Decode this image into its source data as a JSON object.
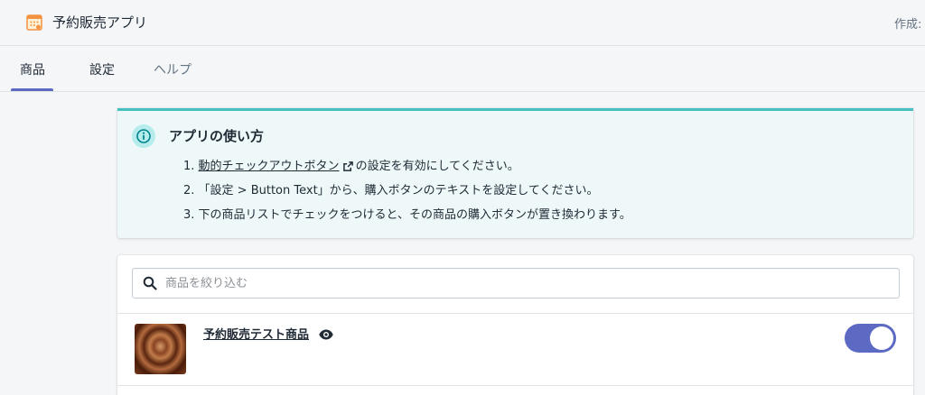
{
  "header": {
    "app_title": "予約販売アプリ",
    "author_label": "作成: ",
    "app_icon": "calendar-icon"
  },
  "tabs": [
    {
      "label": "商品",
      "active": true
    },
    {
      "label": "設定",
      "active": false
    },
    {
      "label": "ヘルプ",
      "active": false
    }
  ],
  "banner": {
    "icon": "info-icon",
    "title": "アプリの使い方",
    "steps": [
      {
        "prefix": "1. ",
        "link": "動的チェックアウトボタン",
        "suffix": "の設定を有効にしてください。"
      },
      {
        "text": "2. 「設定 > Button Text」から、購入ボタンのテキストを設定してください。"
      },
      {
        "text": "3. 下の商品リストでチェックをつけると、その商品の購入ボタンが置き換わります。"
      }
    ]
  },
  "search": {
    "placeholder": "商品を絞り込む",
    "value": ""
  },
  "products": [
    {
      "name": "予約販売テスト商品",
      "enabled": true
    }
  ],
  "colors": {
    "accent": "#5c6ac4",
    "banner_border": "#47c1bf",
    "banner_bg": "#eef8f9"
  }
}
